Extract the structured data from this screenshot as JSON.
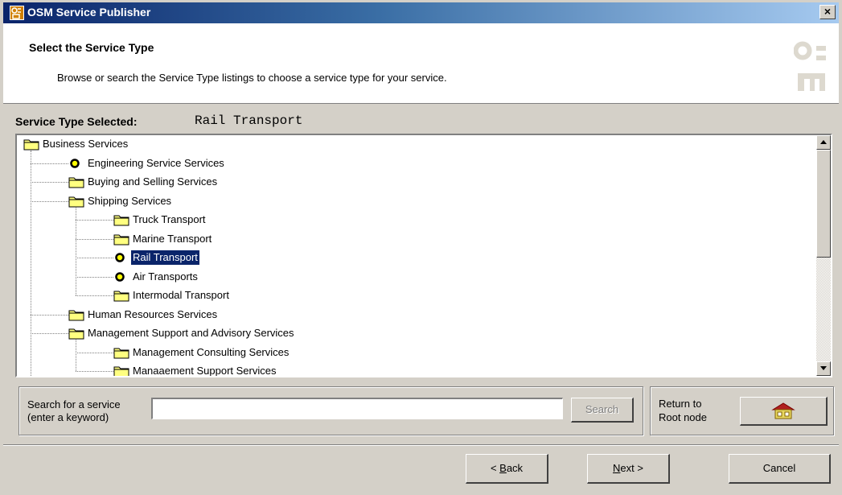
{
  "window": {
    "title": "OSM Service Publisher",
    "close_label": "×"
  },
  "header": {
    "title": "Select the Service Type",
    "subtitle": "Browse or search the Service Type listings to choose a service type for your service.",
    "logo_text": "osm"
  },
  "selection": {
    "label": "Service Type Selected:",
    "value": "Rail Transport"
  },
  "tree": {
    "nodes": [
      {
        "label": "Business Services",
        "icon": "folder-icon",
        "level": 0
      },
      {
        "label": "Engineering Service Services",
        "icon": "circle-node-icon",
        "level": 1
      },
      {
        "label": "Buying and Selling Services",
        "icon": "folder-icon",
        "level": 1
      },
      {
        "label": "Shipping Services",
        "icon": "folder-icon",
        "level": 1
      },
      {
        "label": "Truck Transport",
        "icon": "folder-icon",
        "level": 2
      },
      {
        "label": "Marine Transport",
        "icon": "folder-icon",
        "level": 2
      },
      {
        "label": "Rail Transport",
        "icon": "circle-node-icon",
        "level": 2,
        "selected": true
      },
      {
        "label": "Air Transports",
        "icon": "circle-node-icon",
        "level": 2
      },
      {
        "label": "Intermodal Transport",
        "icon": "folder-icon",
        "level": 2
      },
      {
        "label": "Human Resources Services",
        "icon": "folder-icon",
        "level": 1
      },
      {
        "label": "Management Support and Advisory Services",
        "icon": "folder-icon",
        "level": 1
      },
      {
        "label": "Management Consulting Services",
        "icon": "folder-icon",
        "level": 2
      },
      {
        "label": "Manaaement Support Services",
        "icon": "folder-icon",
        "level": 2
      }
    ]
  },
  "search": {
    "label_line1": "Search for a service",
    "label_line2": "(enter a keyword)",
    "input_value": "",
    "button_label": "Search"
  },
  "root": {
    "label_line1": "Return to",
    "label_line2": "Root node",
    "button_icon": "house-icon"
  },
  "footer": {
    "back_prefix": "< ",
    "back_accel": "B",
    "back_rest": "ack",
    "next_accel": "N",
    "next_rest": "ext >",
    "cancel_label": "Cancel"
  },
  "colors": {
    "titlebar_start": "#0a246a",
    "titlebar_end": "#a6caf0",
    "selection_bg": "#0a246a",
    "folder_yellow": "#ffff80",
    "node_circle": "#ffff00"
  }
}
